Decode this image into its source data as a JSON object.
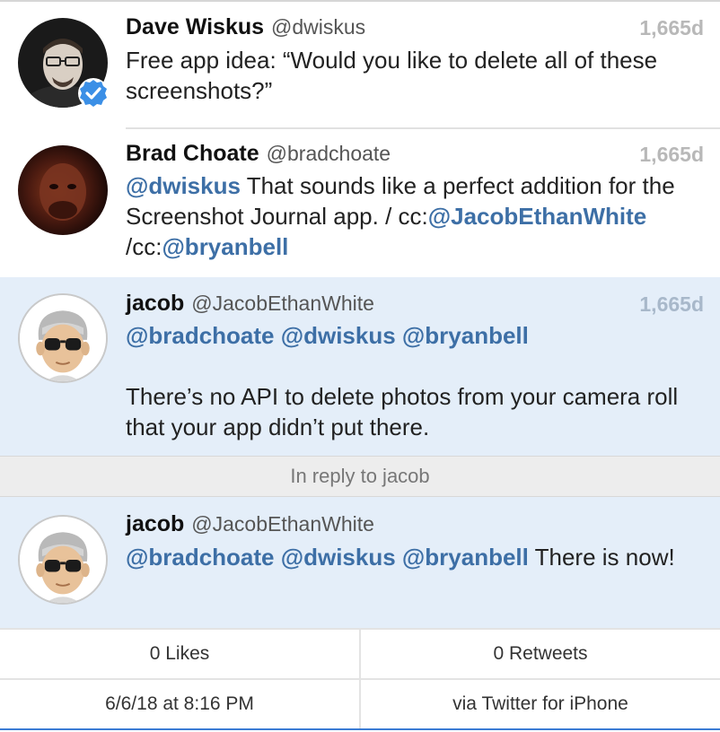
{
  "tweets": [
    {
      "name": "Dave Wiskus",
      "handle": "@dwiskus",
      "time": "1,665d",
      "text": "Free app idea: “Would you like to delete all of these screenshots?”",
      "avatar": "person-photo-avatar",
      "badge": "verified-badge-icon"
    },
    {
      "name": "Brad Choate",
      "handle": "@bradchoate",
      "time": "1,665d",
      "mention1": "@dwiskus",
      "text1": " That sounds like a perfect addition for the Screenshot Journal app. / cc:",
      "mention2": "@JacobEthanWhite",
      "text2": " /cc:",
      "mention3": "@bryanbell",
      "avatar": "person-photo-avatar"
    },
    {
      "name": "jacob",
      "handle": "@JacobEthanWhite",
      "time": "1,665d",
      "mention1": "@bradchoate",
      "mention2": "@dwiskus",
      "mention3": "@bryanbell",
      "text": "There’s no API to delete photos from your camera roll that your app didn’t put there.",
      "avatar": "memoji-sunglasses-avatar"
    },
    {
      "name": "jacob",
      "handle": "@JacobEthanWhite",
      "mention1": "@bradchoate",
      "mention2": "@dwiskus",
      "mention3": "@bryanbell",
      "text": " There is now!",
      "avatar": "memoji-sunglasses-avatar"
    }
  ],
  "reply_context": "In reply to jacob",
  "stats": {
    "likes": "0 Likes",
    "retweets": "0 Retweets",
    "date": "6/6/18 at 8:16 PM",
    "via": "via Twitter for iPhone"
  },
  "colors": {
    "mention": "#3d6fa6",
    "highlight_bg": "#e4eef9",
    "verified": "#3b8fe6"
  }
}
